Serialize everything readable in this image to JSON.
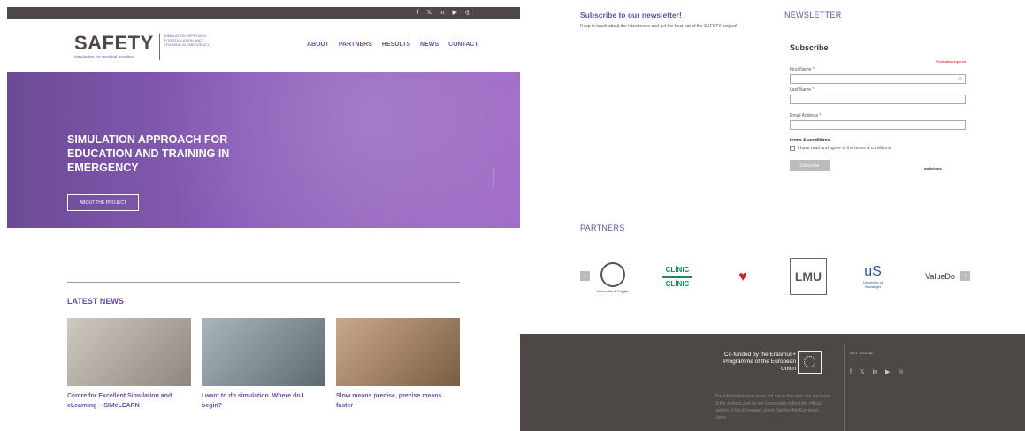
{
  "social_icons": [
    "f",
    "𝕏",
    "in",
    "▶",
    "◎"
  ],
  "logo": {
    "name": "SAFETY",
    "sub": "SIMULATION APPROACH FOR EDUCATION AND TRAINING IN EMERGENCY",
    "tagline": "simulation for medical practice"
  },
  "nav": [
    "ABOUT",
    "PARTNERS",
    "RESULTS",
    "NEWS",
    "CONTACT"
  ],
  "hero": {
    "title": "SIMULATION APPROACH FOR EDUCATION AND TRAINING IN EMERGENCY",
    "button": "ABOUT THE PROJECT",
    "side_text": "Photo: copyright"
  },
  "latest_news": {
    "title": "LATEST NEWS",
    "items": [
      {
        "caption": "Centre for Excellent Simulation and eLearning – SIMeLEARN"
      },
      {
        "caption": "I want to do simulation. Where do I begin?"
      },
      {
        "caption": "Slow means precise, precise means faster"
      }
    ]
  },
  "subscribe": {
    "heading": "Subscribe to our newsletter!",
    "description": "Keep in touch about the latest news and get the best out of the SAFETY project!"
  },
  "newsletter": {
    "heading": "NEWSLETTER",
    "form_title": "Subscribe",
    "required_note": "* indicates required",
    "fields": [
      "First Name *",
      "Last Name *",
      "Email Address *"
    ],
    "terms_heading": "terms & conditions",
    "terms_text": "I have read and agree to the terms & conditions",
    "button": "Subscribe",
    "brand": "mailchimp"
  },
  "partners": {
    "heading": "PARTNERS",
    "prev": "‹",
    "next": "›",
    "items": [
      {
        "name": "Università di Foggia"
      },
      {
        "name": "CLÍNIC",
        "sub": "CLÍNIC"
      },
      {
        "name": "♥"
      },
      {
        "name": "LMU"
      },
      {
        "name": "University of Stavanger"
      },
      {
        "name": "ValueDo"
      }
    ]
  },
  "footer": {
    "eu_text": "Co-funded by the Erasmus+ Programme of the European Union",
    "get_social": "GET SOCIAL",
    "disclaimer": "The information and views set out in this web-site are those of the authors and do not necessarily reflect the official opinion of the European Union. Neither the European Union"
  },
  "colors": {
    "brand": "#6b4fa0",
    "dark": "#4d4846",
    "hero": "#8a5db8"
  }
}
